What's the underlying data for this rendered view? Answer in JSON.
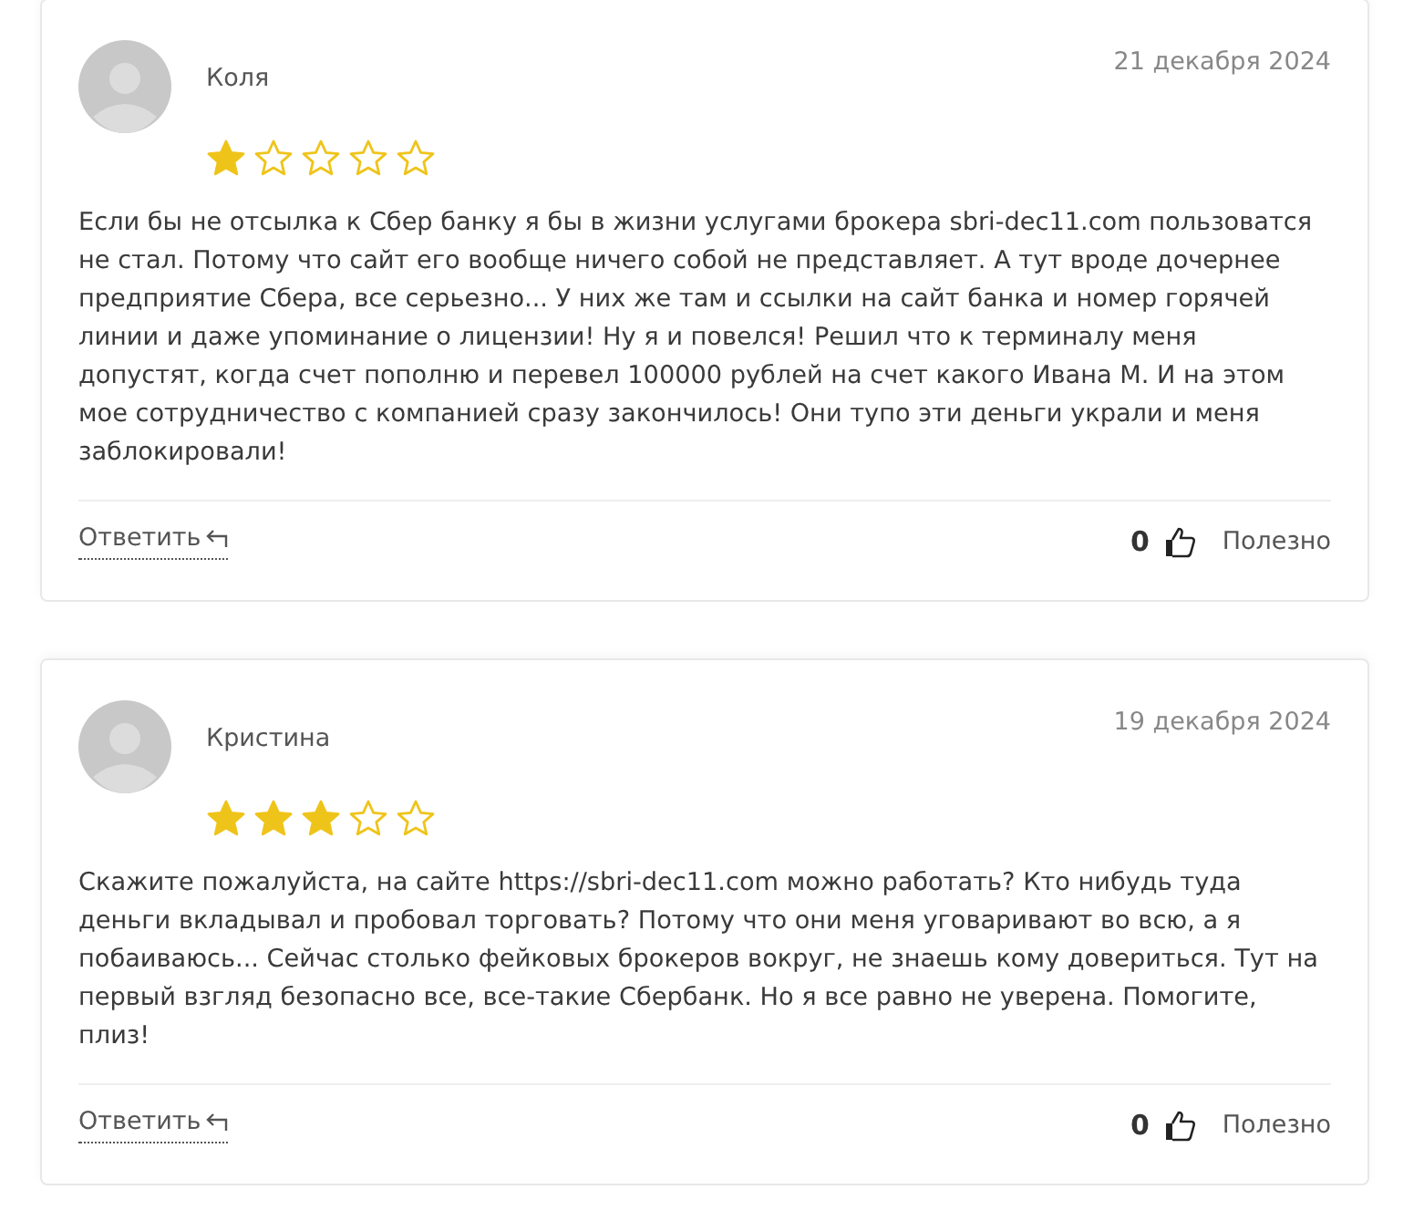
{
  "reviews": [
    {
      "author": "Коля",
      "date": "21 декабря 2024",
      "stars": 1,
      "text": "Если бы не отсылка к Сбер банку я бы в жизни услугами брокера sbri-dec11.com пользоватся не стал. Потому что сайт его вообще ничего собой не представляет. А тут вроде дочернее предприятие Сбера, все серьезно... У них же там и ссылки на сайт банка и номер горячей линии и даже упоминание о лицензии! Ну я и повелся! Решил что к терминалу меня допустят, когда счет пополню и перевел 100000 рублей на счет какого Ивана М. И на этом мое сотрудничество с компанией сразу закончилось! Они тупо эти деньги украли и меня заблокировали!",
      "reply": "Ответить",
      "likes": "0",
      "helpful": "Полезно"
    },
    {
      "author": "Кристина",
      "date": "19 декабря 2024",
      "stars": 3,
      "text": "Скажите пожалуйста, на сайте https://sbri-dec11.com можно работать? Кто нибудь туда деньги вкладывал и пробовал торговать? Потому что они меня уговаривают во всю, а я побаиваюсь... Сейчас столько фейковых брокеров вокруг, не знаешь кому довериться. Тут на первый взгляд безопасно все, все-такие Сбербанк. Но я все равно не уверена. Помогите, плиз!",
      "reply": "Ответить",
      "likes": "0",
      "helpful": "Полезно"
    }
  ]
}
